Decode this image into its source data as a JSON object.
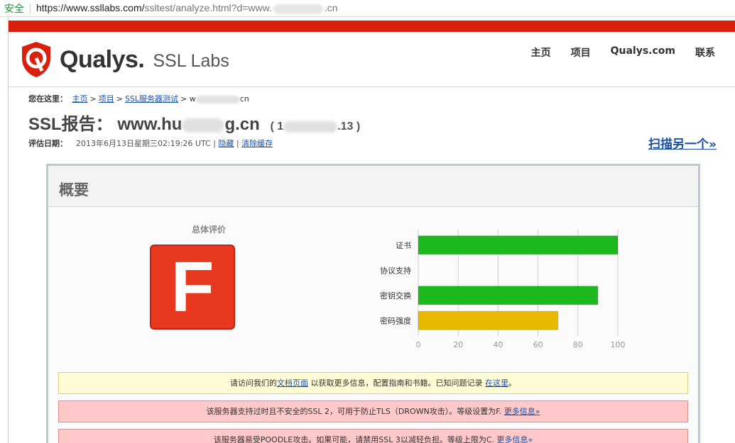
{
  "browser": {
    "secure_label": "安全",
    "url_main": "https://www.ssllabs.com/",
    "url_path": "ssltest/analyze.html?d=www.",
    "url_tail": ".cn"
  },
  "header": {
    "brand": "Qualys.",
    "brand_sub": "SSL Labs",
    "nav": [
      "主页",
      "项目",
      "Qualys.com",
      "联系"
    ]
  },
  "breadcrumb": {
    "prefix": "您在这里：",
    "items": [
      "主页",
      "项目",
      "SSL服务器测试"
    ],
    "current_prefix": "w",
    "current_suffix": "cn",
    "separator": ">"
  },
  "report": {
    "title_prefix": "SSL报告：",
    "host_start": "www.hu",
    "host_end": "g.cn",
    "ip_open": "( 1",
    "ip_close": ".13 )",
    "date_label": "评估日期：",
    "date_value": "2013年6月13日星期三02:19:26 UTC |",
    "hide_link": "隐藏",
    "divider": "|",
    "clear_cache_link": "清除缓存",
    "scan_another": "扫描另一个»"
  },
  "summary": {
    "heading": "概要",
    "overall_label": "总体评价",
    "grade": "F",
    "notices": [
      {
        "pre": "请访问我们的",
        "link1": "文档页面",
        "mid": " 以获取更多信息，配置指南和书籍。已知问题记录 ",
        "link2": "在这里",
        "post": "。"
      },
      {
        "pre": "该服务器支持过时且不安全的SSL 2，可用于防止TLS（DROWN攻击）。等级设置为F.  ",
        "link1": "更多信息»"
      },
      {
        "pre": "该服务器易受POODLE攻击。如果可能，请禁用SSL 3以减轻负担。等级上限为C.  ",
        "link1": "更多信息»"
      }
    ]
  },
  "chart_data": {
    "type": "bar",
    "orientation": "horizontal",
    "categories": [
      "证书",
      "协议支持",
      "密钥交换",
      "密码强度"
    ],
    "values": [
      100,
      0,
      90,
      70
    ],
    "colors": [
      "#1cb81c",
      "#1cb81c",
      "#1cb81c",
      "#e8b800"
    ],
    "xlim": [
      0,
      100
    ],
    "xticks": [
      0,
      20,
      40,
      60,
      80,
      100
    ],
    "grid": true
  },
  "colors": {
    "accent_red": "#d9200f",
    "grade_red": "#e8381f",
    "link_blue": "#1a4fa8"
  }
}
